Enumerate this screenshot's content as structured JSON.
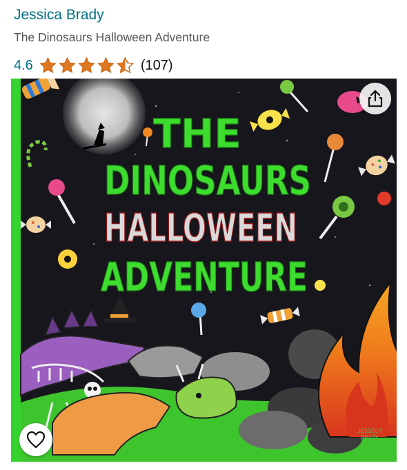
{
  "product": {
    "author": "Jessica Brady",
    "title": "The Dinosaurs Halloween Adventure",
    "rating_value": "4.6",
    "rating": 4.6,
    "rating_max": 5,
    "review_count": "(107)"
  },
  "cover": {
    "title_line1": "THE",
    "title_line2": "DINOSAURS",
    "title_line3": "HALLOWEEN",
    "title_line4": "ADVENTURE",
    "corner_author_line1": "JESSICA",
    "corner_author_line2": "BRADY"
  },
  "colors": {
    "link": "#007185",
    "star": "#de7921",
    "title_green": "#3ddc2f",
    "halloween_red": "#c92a2a",
    "night_sky": "#16161c",
    "border_green": "#35d32d"
  },
  "icons": {
    "share": "share-icon",
    "wishlist": "heart-icon",
    "star_full": "star-full-icon",
    "star_half": "star-half-icon"
  }
}
